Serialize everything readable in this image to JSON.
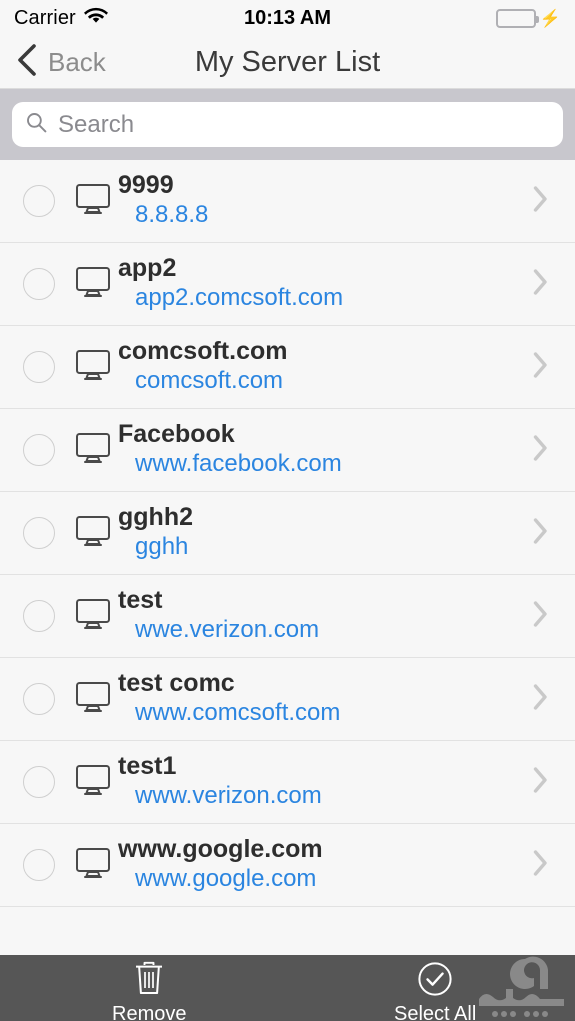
{
  "status_bar": {
    "carrier": "Carrier",
    "wifi_icon": "wifi-icon",
    "time": "10:13 AM",
    "battery_icon": "battery-icon",
    "battery_color": "#4cd964",
    "charging_icon": "bolt-icon"
  },
  "nav_bar": {
    "back_icon": "chevron-left-icon",
    "back_label": "Back",
    "title": "My Server List"
  },
  "search": {
    "icon": "search-icon",
    "placeholder": "Search",
    "value": ""
  },
  "list": {
    "row_icon": "monitor-icon",
    "select_icon": "radio-unchecked-icon",
    "disclosure_icon": "chevron-right-icon",
    "accent_link_color": "#2b85e0",
    "rows": [
      {
        "title": "9999",
        "subtitle": "8.8.8.8",
        "selected": false
      },
      {
        "title": "app2",
        "subtitle": "app2.comcsoft.com",
        "selected": false
      },
      {
        "title": "comcsoft.com",
        "subtitle": "comcsoft.com",
        "selected": false
      },
      {
        "title": "Facebook",
        "subtitle": "www.facebook.com",
        "selected": false
      },
      {
        "title": "gghh2",
        "subtitle": "gghh",
        "selected": false
      },
      {
        "title": "test",
        "subtitle": "wwe.verizon.com",
        "selected": false
      },
      {
        "title": "test comc",
        "subtitle": "www.comcsoft.com",
        "selected": false
      },
      {
        "title": "test1",
        "subtitle": "www.verizon.com",
        "selected": false
      },
      {
        "title": "www.google.com",
        "subtitle": "www.google.com",
        "selected": false
      }
    ]
  },
  "toolbar": {
    "background_color": "#565656",
    "remove_icon": "trash-icon",
    "remove_label": "Remove",
    "select_all_icon": "check-circle-icon",
    "select_all_label": "Select All",
    "watermark_icon": "app-watermark-logo"
  }
}
